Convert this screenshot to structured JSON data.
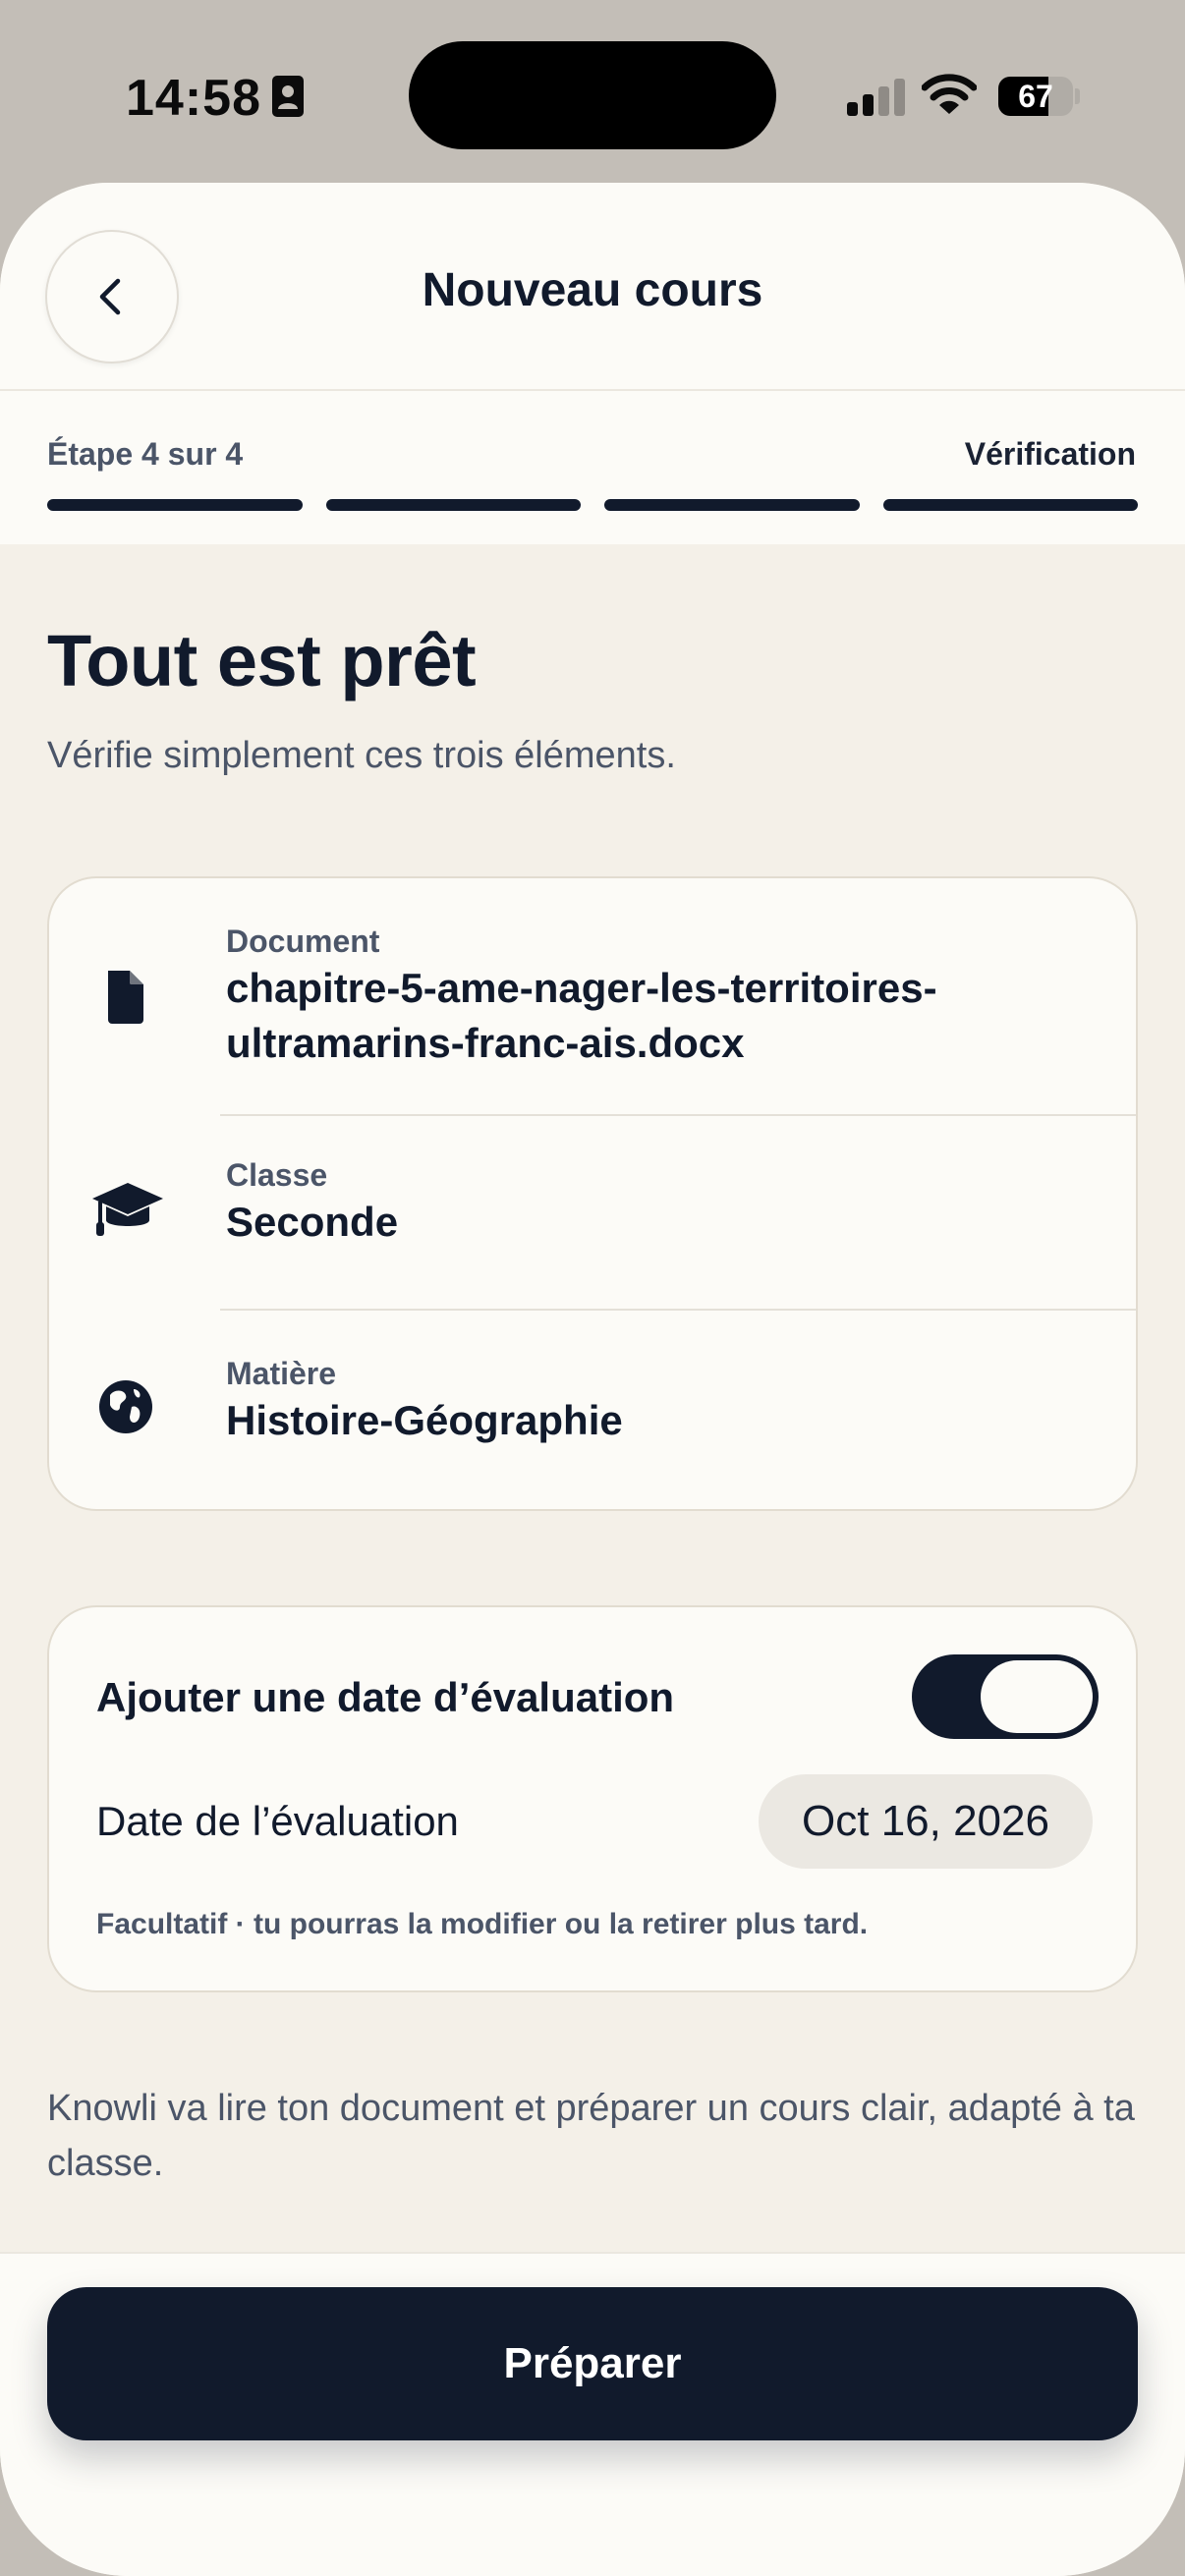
{
  "status_bar": {
    "time": "14:58",
    "battery_level": "67",
    "battery_fraction": 0.67,
    "icons": [
      "id-card-icon",
      "cellular-signal-icon",
      "wifi-icon",
      "battery-icon"
    ]
  },
  "nav": {
    "title": "Nouveau cours",
    "back_icon": "chevron-left-icon"
  },
  "progress": {
    "step_label": "Étape 4 sur 4",
    "step_name": "Vérification",
    "current_step": 4,
    "total_steps": 4
  },
  "main": {
    "heading": "Tout est prêt",
    "subheading": "Vérifie simplement ces trois éléments."
  },
  "summary": {
    "items": [
      {
        "icon": "document-icon",
        "label": "Document",
        "value": "chapitre-5-ame-nager-les-territoires-ultramarins-franc-ais.docx"
      },
      {
        "icon": "graduation-cap-icon",
        "label": "Classe",
        "value": "Seconde"
      },
      {
        "icon": "globe-icon",
        "label": "Matière",
        "value": "Histoire-Géographie"
      }
    ]
  },
  "evaluation": {
    "toggle_label": "Ajouter une date d’évaluation",
    "toggle_on": true,
    "date_label": "Date de l’évaluation",
    "date_value": "Oct 16, 2026",
    "note": "Facultatif · tu pourras la modifier ou la retirer plus tard."
  },
  "info_text": "Knowli va lire ton document et préparer un cours clair, adapté à ta classe.",
  "footer": {
    "prepare_label": "Préparer"
  },
  "colors": {
    "accent": "#111a2c",
    "background": "#f4f0e8",
    "card": "#fcfbf7",
    "muted_text": "#4b5568",
    "outer_background": "#c3beb7"
  }
}
